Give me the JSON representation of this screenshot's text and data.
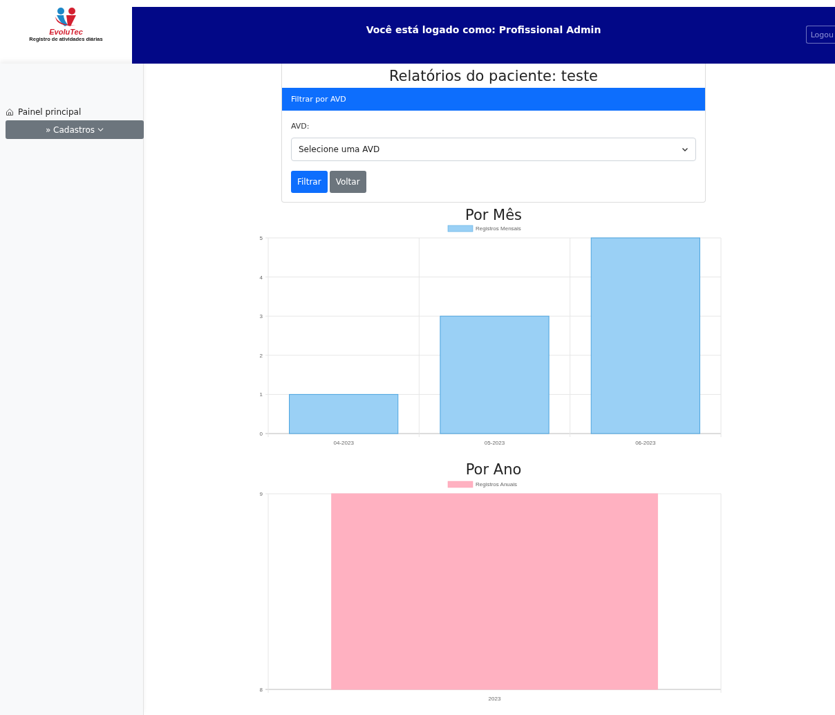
{
  "logo": {
    "brand": "EvoluTec",
    "tagline": "Registro de atividades diárias"
  },
  "header": {
    "text": "Você está logado como: Profissional Admin",
    "logout": "Logou"
  },
  "sidebar": {
    "items": [
      {
        "label": "Painel principal",
        "kind": "link"
      },
      {
        "label": "» Cadastros",
        "kind": "dropdown",
        "expanded": false
      }
    ]
  },
  "card": {
    "title": "Relatórios do paciente: teste",
    "header": "Filtrar por AVD",
    "field_label": "AVD:",
    "select": {
      "value": "Selecione uma AVD"
    },
    "buttons": [
      {
        "label": "Filtrar",
        "kind": "primary"
      },
      {
        "label": "Voltar",
        "kind": "secondary"
      }
    ]
  },
  "charts": [
    {
      "heading": "Por Mês",
      "chart_data": {
        "type": "bar",
        "categories": [
          "04-2023",
          "05-2023",
          "06-2023"
        ],
        "series": [
          {
            "name": "Registros Mensais",
            "color": "#9ad0f5",
            "values": [
              1,
              3,
              5
            ]
          }
        ],
        "ylim": [
          0,
          5
        ],
        "grid": true,
        "yticks": [
          0,
          1,
          2,
          3,
          4,
          5
        ]
      }
    },
    {
      "heading": "Por Ano",
      "chart_data": {
        "type": "bar",
        "categories": [
          "2023"
        ],
        "series": [
          {
            "name": "Registros Anuais",
            "color": "#ffb1c1",
            "values": [
              9
            ]
          }
        ],
        "ylim": [
          8,
          9
        ],
        "grid": true,
        "yticks": [
          8,
          9
        ]
      }
    }
  ]
}
